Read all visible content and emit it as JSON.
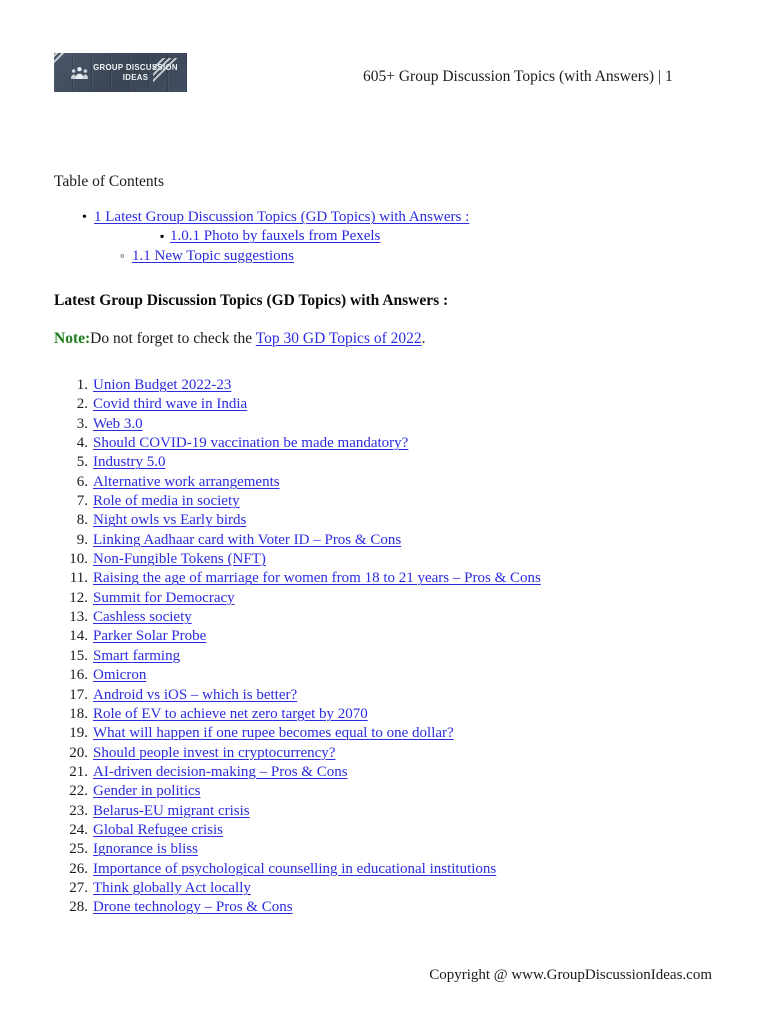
{
  "header": {
    "logo": {
      "alt": "Group Discussion Ideas logo",
      "text_line1": "GROUP DISCUSSION",
      "text_line2": "IDEAS",
      "background_color": "#3d4a5a"
    },
    "title": "605+ Group Discussion Topics (with Answers) | 1"
  },
  "toc": {
    "title": "Table of Contents",
    "items": [
      {
        "level": 1,
        "label": "1 Latest Group Discussion Topics (GD Topics) with Answers :"
      },
      {
        "level": 3,
        "label": "1.0.1 Photo by fauxels from Pexels"
      },
      {
        "level": 2,
        "label": "1.1 New Topic suggestions"
      }
    ]
  },
  "section": {
    "heading": "Latest Group Discussion Topics (GD Topics) with Answers :",
    "note": {
      "label": "Note:",
      "text_before": "Do not forget to check the ",
      "link": "Top 30 GD Topics of 2022",
      "text_after": "."
    }
  },
  "topics": {
    "items": [
      {
        "number": "1.",
        "label": "Union Budget 2022-23"
      },
      {
        "number": "2.",
        "label": "Covid third wave in India"
      },
      {
        "number": "3.",
        "label": "Web 3.0"
      },
      {
        "number": "4.",
        "label": "Should COVID-19 vaccination be made mandatory?"
      },
      {
        "number": "5.",
        "label": "Industry 5.0"
      },
      {
        "number": "6.",
        "label": "Alternative work arrangements"
      },
      {
        "number": "7.",
        "label": "Role of media in society"
      },
      {
        "number": "8.",
        "label": "Night owls vs Early birds"
      },
      {
        "number": "9.",
        "label": "Linking Aadhaar card with Voter ID – Pros & Cons"
      },
      {
        "number": "10.",
        "label": "Non-Fungible Tokens (NFT)"
      },
      {
        "number": "11.",
        "label": "Raising the age of marriage for women from 18 to 21 years – Pros & Cons"
      },
      {
        "number": "12.",
        "label": "Summit for Democracy"
      },
      {
        "number": "13.",
        "label": "Cashless society"
      },
      {
        "number": "14.",
        "label": "Parker Solar Probe"
      },
      {
        "number": "15.",
        "label": "Smart farming"
      },
      {
        "number": "16.",
        "label": "Omicron"
      },
      {
        "number": "17.",
        "label": "Android vs iOS – which is better?"
      },
      {
        "number": "18.",
        "label": "Role of EV to achieve net zero target by 2070"
      },
      {
        "number": "19.",
        "label": "What will happen if one rupee becomes equal to one dollar?"
      },
      {
        "number": "20.",
        "label": "Should people invest in cryptocurrency?"
      },
      {
        "number": "21.",
        "label": "AI-driven decision-making – Pros & Cons"
      },
      {
        "number": "22.",
        "label": "Gender in politics"
      },
      {
        "number": "23.",
        "label": "Belarus-EU migrant crisis"
      },
      {
        "number": "24.",
        "label": "Global Refugee crisis"
      },
      {
        "number": "25.",
        "label": "Ignorance is bliss"
      },
      {
        "number": "26.",
        "label": "Importance of psychological counselling in educational institutions"
      },
      {
        "number": "27.",
        "label": "Think globally Act locally"
      },
      {
        "number": "28.",
        "label": "Drone technology – Pros & Cons"
      }
    ]
  },
  "footer": {
    "copyright": "Copyright @ www.GroupDiscussionIdeas.com"
  },
  "colors": {
    "link": "#2b2be0",
    "note_label": "#1a7d1a",
    "text": "#1b1b1b"
  }
}
